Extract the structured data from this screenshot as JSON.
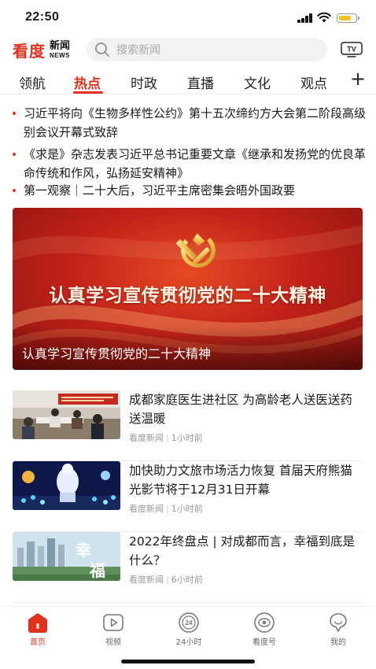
{
  "status_bar": {
    "time": "22:50"
  },
  "header": {
    "brand": "看度",
    "brand_sub_cn": "新闻",
    "brand_sub_en": "NEWS",
    "search_placeholder": "搜索新闻",
    "tv_label": "TV"
  },
  "tabs": [
    {
      "label": "领航",
      "active": false
    },
    {
      "label": "热点",
      "active": true
    },
    {
      "label": "时政",
      "active": false
    },
    {
      "label": "直播",
      "active": false
    },
    {
      "label": "文化",
      "active": false
    },
    {
      "label": "观点",
      "active": false
    }
  ],
  "tab_add_label": "+",
  "headlines": [
    "习近平将向《生物多样性公约》第十五次缔约方大会第二阶段高级别会议开幕式致辞",
    "《求是》杂志发表习近平总书记重要文章《继承和发扬党的优良革命传统和作风，弘扬延安精神》",
    "第一观察｜二十大后，习近平主席密集会晤外国政要"
  ],
  "banner": {
    "headline": "认真学习宣传贯彻党的二十大精神",
    "caption": "认真学习宣传贯彻党的二十大精神"
  },
  "news": [
    {
      "title": "成都家庭医生进社区 为高龄老人送医送药送温暖",
      "source": "看度新闻",
      "time": "1小时前"
    },
    {
      "title": "加快助力文旅市场活力恢复 首届天府熊猫光影节将于12月31日开幕",
      "source": "看度新闻",
      "time": "1小时前"
    },
    {
      "title": "2022年终盘点 | 对成都而言，幸福到底是什么？",
      "source": "看度新闻",
      "time": "6小时前",
      "thumb_text": "幸福"
    }
  ],
  "bottom_nav": [
    {
      "label": "首页",
      "icon": "home-icon",
      "active": true
    },
    {
      "label": "视频",
      "icon": "video-icon",
      "active": false
    },
    {
      "label": "24小时",
      "icon": "24-hours-icon",
      "active": false
    },
    {
      "label": "看度号",
      "icon": "eye-icon",
      "active": false
    },
    {
      "label": "我的",
      "icon": "profile-icon",
      "active": false
    }
  ],
  "colors": {
    "accent": "#e0321d",
    "battery": "#f6c324",
    "meta_text": "#999999"
  }
}
